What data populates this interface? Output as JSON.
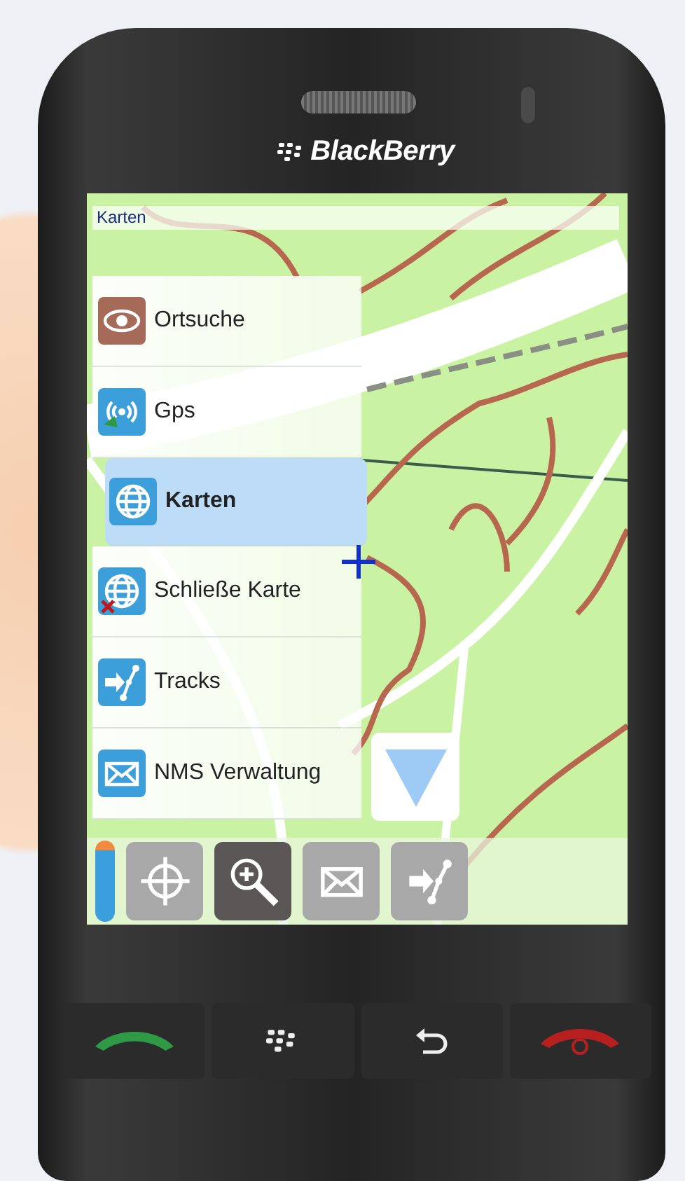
{
  "brand": {
    "logo_text": "BlackBerry"
  },
  "screen": {
    "title": "Karten",
    "menu": [
      {
        "label": "Ortsuche",
        "kind": "eye",
        "selected": false
      },
      {
        "label": "Gps",
        "kind": "gps",
        "selected": false
      },
      {
        "label": "Karten",
        "kind": "globe",
        "selected": true
      },
      {
        "label": "Schließe Karte",
        "kind": "globe-close",
        "selected": false
      },
      {
        "label": "Tracks",
        "kind": "tracks",
        "selected": false
      },
      {
        "label": "NMS Verwaltung",
        "kind": "mail",
        "selected": false
      }
    ],
    "toolbar": [
      {
        "kind": "crosshair",
        "selected": false
      },
      {
        "kind": "zoom",
        "selected": true
      },
      {
        "kind": "mail",
        "selected": false
      },
      {
        "kind": "tracks",
        "selected": false
      }
    ]
  }
}
